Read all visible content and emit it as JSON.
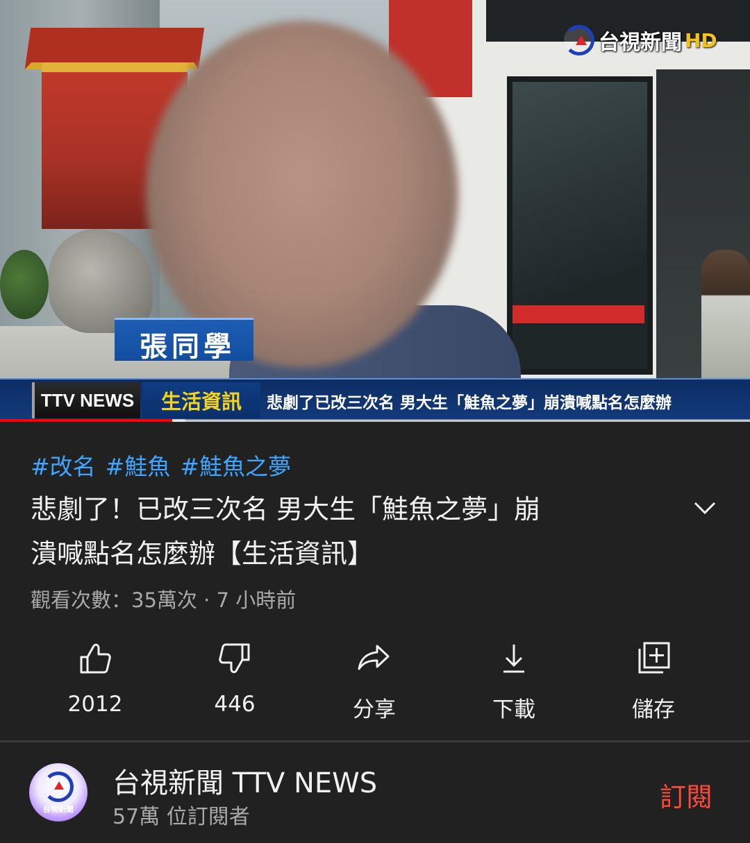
{
  "video": {
    "channel_logo_text": "台視新聞",
    "channel_logo_hd": "HD",
    "nameplate": "張同學",
    "ticker": {
      "brand": "TTV NEWS",
      "category": "生活資訊",
      "headline": "悲劇了已改三次名 男大生「鮭魚之夢」崩潰喊點名怎麼辦"
    },
    "progress_fraction": 0.23,
    "buffer_fraction": 0.248
  },
  "info": {
    "hashtags": [
      "#改名",
      "#鮭魚",
      "#鮭魚之夢"
    ],
    "title_line1": "悲劇了！已改三次名  男大生「鮭魚之夢」崩",
    "title_line2": "潰喊點名怎麼辦【生活資訊】",
    "expand_icon": "chevron-down-icon",
    "meta": "觀看次數：35萬次 · 7 小時前"
  },
  "actions": [
    {
      "icon": "thumbs-up-icon",
      "label": "2012"
    },
    {
      "icon": "thumbs-down-icon",
      "label": "446"
    },
    {
      "icon": "share-icon",
      "label": "分享"
    },
    {
      "icon": "download-icon",
      "label": "下載"
    },
    {
      "icon": "save-playlist-icon",
      "label": "儲存"
    }
  ],
  "channel": {
    "avatar_text": "台視新聞",
    "name": "台視新聞 TTV NEWS",
    "subscribers": "57萬 位訂閱者",
    "subscribe_label": "訂閱"
  },
  "colors": {
    "background": "#212121",
    "hashtag": "#3ea6ff",
    "subscribe": "#ff4a3a",
    "progress": "#ff0000",
    "ticker_category": "#f6d21b"
  }
}
